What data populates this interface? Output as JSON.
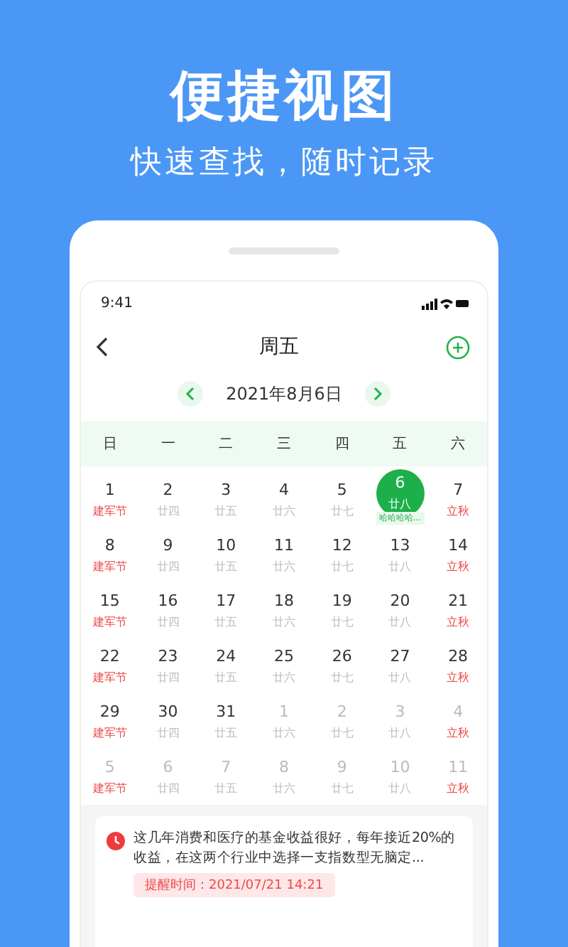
{
  "headline": "便捷视图",
  "subheadline": "快速查找，随时记录",
  "status_bar": {
    "time": "9:41"
  },
  "header": {
    "title": "周五"
  },
  "date_nav": {
    "date": "2021年8月6日"
  },
  "weekdays": [
    "日",
    "一",
    "二",
    "三",
    "四",
    "五",
    "六"
  ],
  "weeks": [
    [
      {
        "date": "1",
        "lunar": "建军节",
        "festive": true,
        "other_month": false,
        "selected": false
      },
      {
        "date": "2",
        "lunar": "廿四",
        "festive": false,
        "other_month": false,
        "selected": false
      },
      {
        "date": "3",
        "lunar": "廿五",
        "festive": false,
        "other_month": false,
        "selected": false
      },
      {
        "date": "4",
        "lunar": "廿六",
        "festive": false,
        "other_month": false,
        "selected": false
      },
      {
        "date": "5",
        "lunar": "廿七",
        "festive": false,
        "other_month": false,
        "selected": false
      },
      {
        "date": "6",
        "lunar": "廿八",
        "festive": false,
        "other_month": false,
        "selected": true,
        "event": "哈哈哈哈..."
      },
      {
        "date": "7",
        "lunar": "立秋",
        "festive": true,
        "other_month": false,
        "selected": false
      }
    ],
    [
      {
        "date": "8",
        "lunar": "建军节",
        "festive": true,
        "other_month": false,
        "selected": false
      },
      {
        "date": "9",
        "lunar": "廿四",
        "festive": false,
        "other_month": false,
        "selected": false
      },
      {
        "date": "10",
        "lunar": "廿五",
        "festive": false,
        "other_month": false,
        "selected": false
      },
      {
        "date": "11",
        "lunar": "廿六",
        "festive": false,
        "other_month": false,
        "selected": false
      },
      {
        "date": "12",
        "lunar": "廿七",
        "festive": false,
        "other_month": false,
        "selected": false
      },
      {
        "date": "13",
        "lunar": "廿八",
        "festive": false,
        "other_month": false,
        "selected": false
      },
      {
        "date": "14",
        "lunar": "立秋",
        "festive": true,
        "other_month": false,
        "selected": false
      }
    ],
    [
      {
        "date": "15",
        "lunar": "建军节",
        "festive": true,
        "other_month": false,
        "selected": false
      },
      {
        "date": "16",
        "lunar": "廿四",
        "festive": false,
        "other_month": false,
        "selected": false
      },
      {
        "date": "17",
        "lunar": "廿五",
        "festive": false,
        "other_month": false,
        "selected": false
      },
      {
        "date": "18",
        "lunar": "廿六",
        "festive": false,
        "other_month": false,
        "selected": false
      },
      {
        "date": "19",
        "lunar": "廿七",
        "festive": false,
        "other_month": false,
        "selected": false
      },
      {
        "date": "20",
        "lunar": "廿八",
        "festive": false,
        "other_month": false,
        "selected": false
      },
      {
        "date": "21",
        "lunar": "立秋",
        "festive": true,
        "other_month": false,
        "selected": false
      }
    ],
    [
      {
        "date": "22",
        "lunar": "建军节",
        "festive": true,
        "other_month": false,
        "selected": false
      },
      {
        "date": "23",
        "lunar": "廿四",
        "festive": false,
        "other_month": false,
        "selected": false
      },
      {
        "date": "24",
        "lunar": "廿五",
        "festive": false,
        "other_month": false,
        "selected": false
      },
      {
        "date": "25",
        "lunar": "廿六",
        "festive": false,
        "other_month": false,
        "selected": false
      },
      {
        "date": "26",
        "lunar": "廿七",
        "festive": false,
        "other_month": false,
        "selected": false
      },
      {
        "date": "27",
        "lunar": "廿八",
        "festive": false,
        "other_month": false,
        "selected": false
      },
      {
        "date": "28",
        "lunar": "立秋",
        "festive": true,
        "other_month": false,
        "selected": false
      }
    ],
    [
      {
        "date": "29",
        "lunar": "建军节",
        "festive": true,
        "other_month": false,
        "selected": false
      },
      {
        "date": "30",
        "lunar": "廿四",
        "festive": false,
        "other_month": false,
        "selected": false
      },
      {
        "date": "31",
        "lunar": "廿五",
        "festive": false,
        "other_month": false,
        "selected": false
      },
      {
        "date": "1",
        "lunar": "廿六",
        "festive": false,
        "other_month": true,
        "selected": false
      },
      {
        "date": "2",
        "lunar": "廿七",
        "festive": false,
        "other_month": true,
        "selected": false
      },
      {
        "date": "3",
        "lunar": "廿八",
        "festive": false,
        "other_month": true,
        "selected": false
      },
      {
        "date": "4",
        "lunar": "立秋",
        "festive": true,
        "other_month": true,
        "selected": false
      }
    ],
    [
      {
        "date": "5",
        "lunar": "建军节",
        "festive": true,
        "other_month": true,
        "selected": false
      },
      {
        "date": "6",
        "lunar": "廿四",
        "festive": false,
        "other_month": true,
        "selected": false
      },
      {
        "date": "7",
        "lunar": "廿五",
        "festive": false,
        "other_month": true,
        "selected": false
      },
      {
        "date": "8",
        "lunar": "廿六",
        "festive": false,
        "other_month": true,
        "selected": false
      },
      {
        "date": "9",
        "lunar": "廿七",
        "festive": false,
        "other_month": true,
        "selected": false
      },
      {
        "date": "10",
        "lunar": "廿八",
        "festive": false,
        "other_month": true,
        "selected": false
      },
      {
        "date": "11",
        "lunar": "立秋",
        "festive": true,
        "other_month": true,
        "selected": false
      }
    ]
  ],
  "reminder": {
    "text": "这几年消费和医疗的基金收益很好，每年接近20%的收益，在这两个行业中选择一支指数型无脑定...",
    "time": "提醒时间：2021/07/21 14:21"
  }
}
